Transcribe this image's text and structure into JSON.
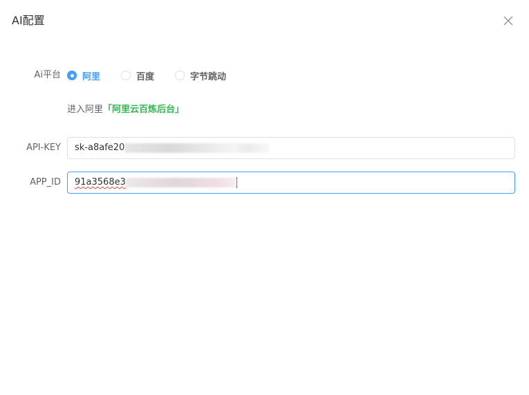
{
  "dialog": {
    "title": "AI配置",
    "close_icon": "close-icon"
  },
  "form": {
    "platform": {
      "label": "Ai平台",
      "options": [
        {
          "label": "阿里",
          "checked": true
        },
        {
          "label": "百度",
          "checked": false
        },
        {
          "label": "字节跳动",
          "checked": false
        }
      ]
    },
    "link_prefix": "进入阿里",
    "link_text": "「阿里云百炼后台」",
    "api_key": {
      "label": "API-KEY",
      "value_visible": "sk-a8afe20"
    },
    "app_id": {
      "label": "APP_ID",
      "value_visible": "91a3568e3"
    }
  },
  "colors": {
    "primary": "#409eff",
    "link": "#2fbb4f"
  }
}
